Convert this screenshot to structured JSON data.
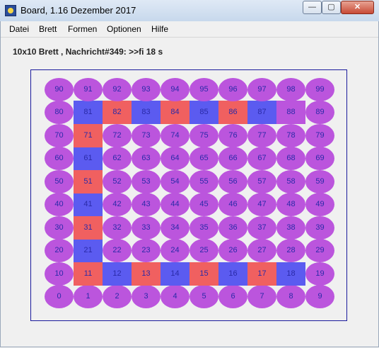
{
  "window": {
    "title": "Board, 1.16 Dezember 2017",
    "buttons": {
      "minimize": "—",
      "maximize": "▢",
      "close": "✕"
    }
  },
  "menu": [
    "Datei",
    "Brett",
    "Formen",
    "Optionen",
    "Hilfe"
  ],
  "status": "10x10 Brett , Nachricht#349: >>fi 18 s",
  "board": {
    "cols": 10,
    "rows": 10,
    "colors": {
      "oval": "#bb55dd",
      "red": "#f06060",
      "blue": "#5b5bf0",
      "number": "#2a2aa8"
    },
    "squares": {
      "11": "red",
      "12": "blue",
      "13": "red",
      "14": "blue",
      "15": "red",
      "16": "blue",
      "17": "red",
      "18": "blue",
      "21": "blue",
      "31": "red",
      "41": "blue",
      "51": "red",
      "61": "blue",
      "71": "red",
      "81": "blue",
      "82": "red",
      "83": "blue",
      "84": "red",
      "85": "blue",
      "86": "red",
      "87": "blue",
      "88": "purple"
    }
  }
}
